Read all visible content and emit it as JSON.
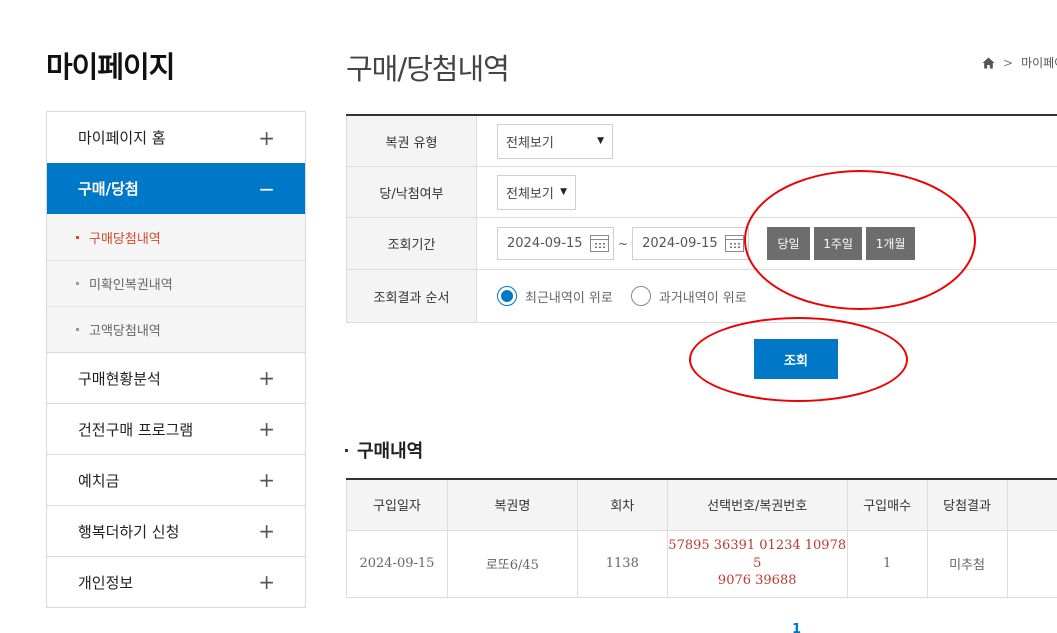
{
  "sidebar": {
    "title": "마이페이지",
    "items": [
      {
        "label": "마이페이지 홈",
        "sign": "+"
      },
      {
        "label": "구매/당첨",
        "sign": "−"
      }
    ],
    "sub_items": [
      {
        "label": "구매당첨내역"
      },
      {
        "label": "미확인복권내역"
      },
      {
        "label": "고액당첨내역"
      }
    ],
    "more_items": [
      {
        "label": "구매현황분석",
        "sign": "+"
      },
      {
        "label": "건전구매 프로그램",
        "sign": "+"
      },
      {
        "label": "예치금",
        "sign": "+"
      },
      {
        "label": "행복더하기 신청",
        "sign": "+"
      },
      {
        "label": "개인정보",
        "sign": "+"
      }
    ]
  },
  "header": {
    "title": "구매/당첨내역",
    "breadcrumb": {
      "separator": ">",
      "current": "마이페이"
    }
  },
  "search": {
    "lottery_type": {
      "label": "복권 유형",
      "value": "전체보기"
    },
    "win_status": {
      "label": "당/낙첨여부",
      "value": "전체보기"
    },
    "period": {
      "label": "조회기간",
      "start_date": "2024-09-15",
      "tilde": "~",
      "end_date": "2024-09-15",
      "buttons": [
        "당일",
        "1주일",
        "1개월"
      ]
    },
    "order": {
      "label": "조회결과 순서",
      "options": [
        "최근내역이 위로",
        "과거내역이 위로"
      ],
      "selected_index": 0
    },
    "submit_label": "조회"
  },
  "results": {
    "title": "구매내역",
    "columns": [
      "구입일자",
      "복권명",
      "회차",
      "선택번호/복권번호",
      "구입매수",
      "당첨결과",
      ""
    ],
    "rows": [
      {
        "date": "2024-09-15",
        "name": "로또6/45",
        "round": "1138",
        "numbers_line1": "57895 36391 01234 10978 5",
        "numbers_line2": "9076 39688",
        "count": "1",
        "result": "미추첨",
        "extra": ""
      }
    ]
  },
  "pagination": {
    "current": "1"
  },
  "colors": {
    "accent": "#0078c8",
    "highlight": "#d64a2a",
    "annotation": "#e00000"
  }
}
